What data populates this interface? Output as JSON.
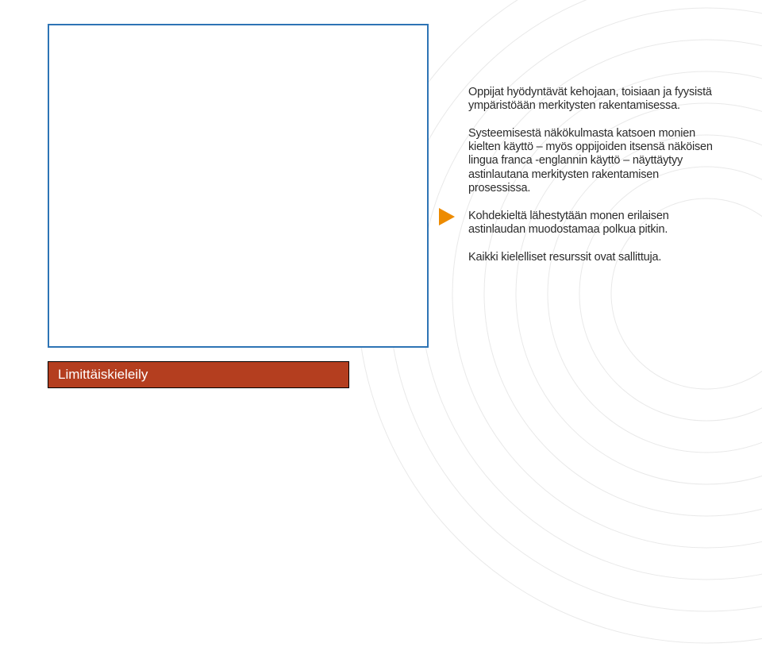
{
  "content": {
    "para1": "Oppijat hyödyntävät kehojaan, toisiaan ja fyysistä ympäristöään merkitysten rakentamisessa.",
    "para2": "Systeemisestä näkökulmasta katsoen monien kielten käyttö – myös oppijoiden itsensä näköisen lingua franca -englannin käyttö – näyttäytyy astinlautana merkitysten rakentamisen prosessissa.",
    "para3": "Kohdekieltä lähestytään monen erilaisen astinlaudan muodostamaa polkua pitkin.",
    "para4": "Kaikki kielelliset resurssit ovat sallittuja."
  },
  "title": "Limittäiskieleily"
}
